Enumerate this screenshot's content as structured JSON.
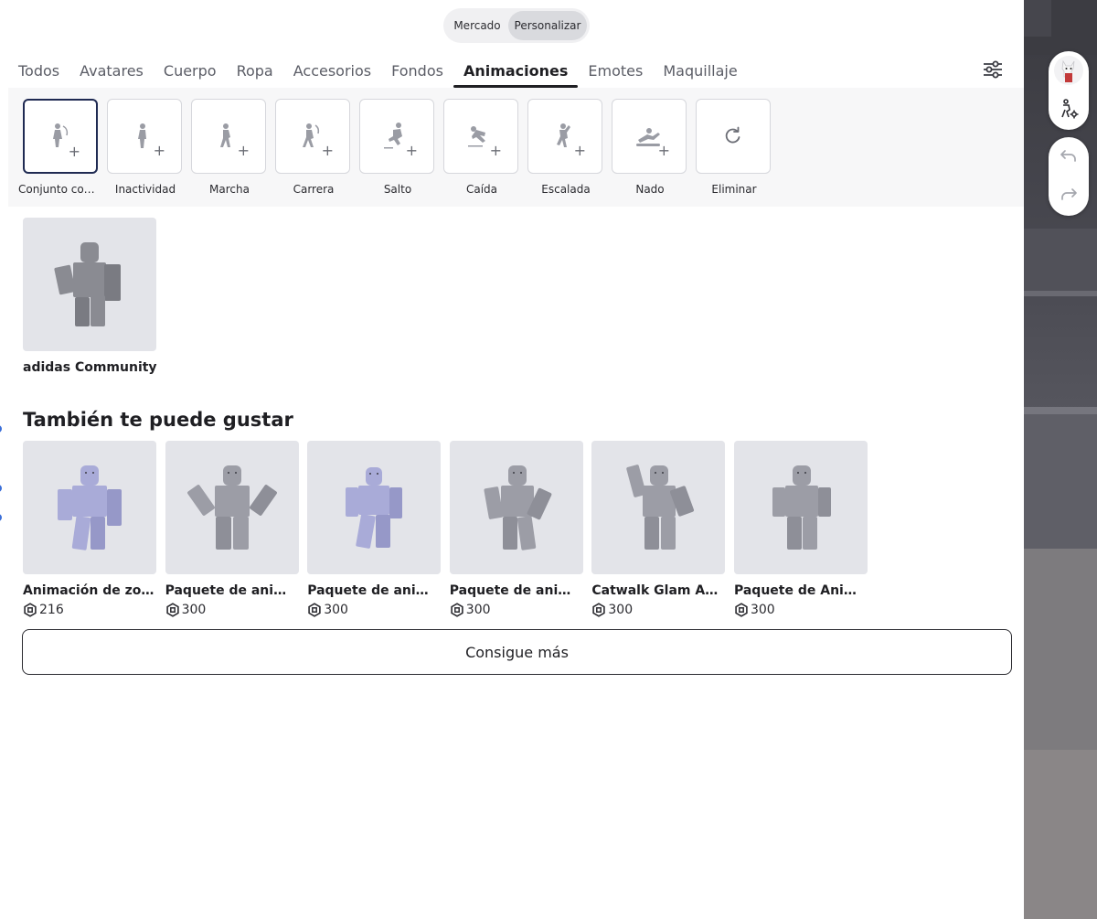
{
  "switch": {
    "market": "Mercado",
    "customize": "Personalizar"
  },
  "tabs": [
    {
      "label": "Todos"
    },
    {
      "label": "Avatares"
    },
    {
      "label": "Cuerpo"
    },
    {
      "label": "Ropa"
    },
    {
      "label": "Accesorios"
    },
    {
      "label": "Fondos"
    },
    {
      "label": "Animaciones",
      "active": true
    },
    {
      "label": "Emotes"
    },
    {
      "label": "Maquillaje"
    }
  ],
  "slots": [
    {
      "label": "Conjunto completo",
      "icon": "pose-full-icon",
      "selected": true
    },
    {
      "label": "Inactividad",
      "icon": "idle-icon"
    },
    {
      "label": "Marcha",
      "icon": "walk-icon"
    },
    {
      "label": "Carrera",
      "icon": "run-icon"
    },
    {
      "label": "Salto",
      "icon": "jump-icon"
    },
    {
      "label": "Caída",
      "icon": "fall-icon"
    },
    {
      "label": "Escalada",
      "icon": "climb-icon"
    },
    {
      "label": "Nado",
      "icon": "swim-icon"
    },
    {
      "label": "Eliminar",
      "icon": "reset-icon"
    }
  ],
  "owned": {
    "name": "adidas Community"
  },
  "recommendations": {
    "title": "También te puede gustar",
    "items": [
      {
        "name": "Animación de zombi",
        "price": "216"
      },
      {
        "name": "Paquete de animación",
        "price": "300"
      },
      {
        "name": "Paquete de animación",
        "price": "300"
      },
      {
        "name": "Paquete de animación",
        "price": "300"
      },
      {
        "name": "Catwalk Glam Animation",
        "price": "300"
      },
      {
        "name": "Paquete de Animación",
        "price": "300"
      }
    ],
    "more": "Consigue más"
  },
  "colors": {
    "accent": "#1f2a52",
    "thumb_bg": "#e3e4e9",
    "avatar_purple": "#a9abd8",
    "avatar_gray": "#9c9da6"
  }
}
